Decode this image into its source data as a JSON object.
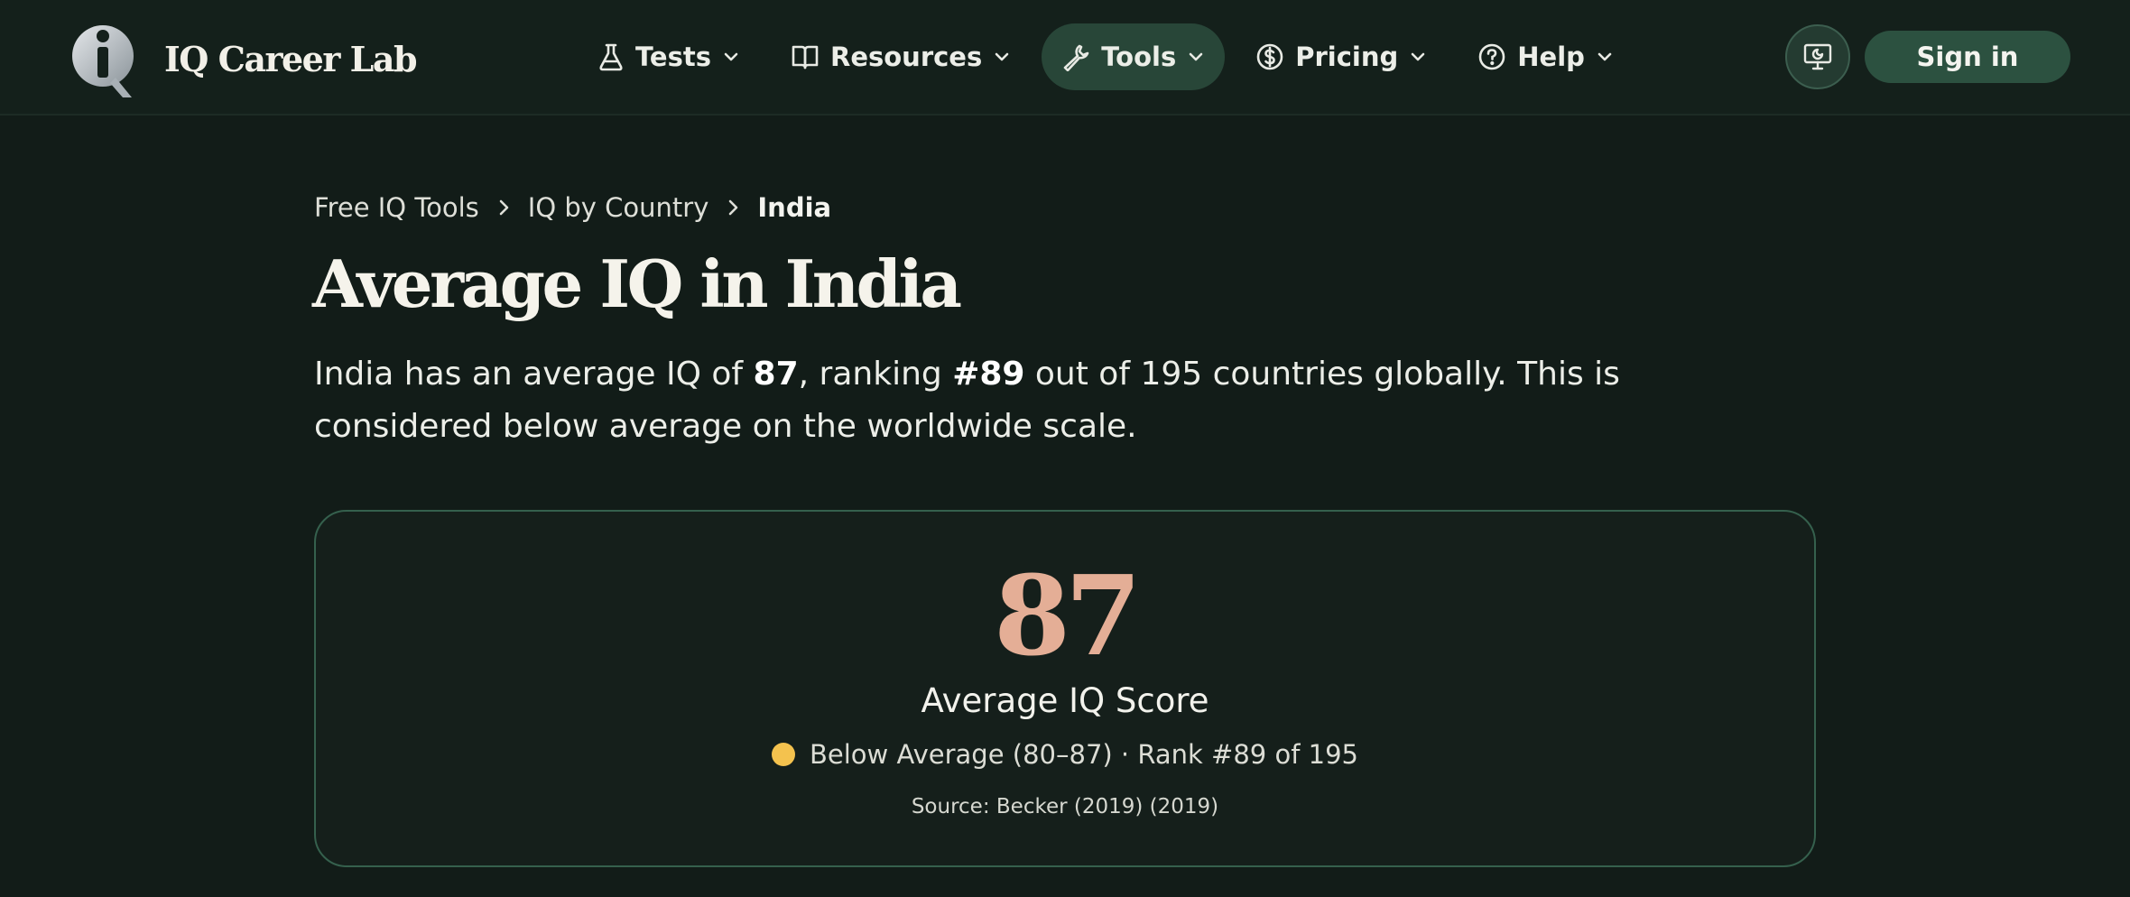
{
  "brand": {
    "name": "IQ Career Lab"
  },
  "nav": {
    "items": [
      {
        "label": "Tests",
        "icon": "flask-icon"
      },
      {
        "label": "Resources",
        "icon": "book-icon"
      },
      {
        "label": "Tools",
        "icon": "wrench-icon",
        "active": true
      },
      {
        "label": "Pricing",
        "icon": "dollar-circle-icon"
      },
      {
        "label": "Help",
        "icon": "help-circle-icon"
      }
    ],
    "theme_toggle_icon": "monitor-icon",
    "signin_label": "Sign in"
  },
  "breadcrumb": {
    "items": [
      "Free IQ Tools",
      "IQ by Country"
    ],
    "current": "India"
  },
  "page": {
    "title": "Average IQ in India",
    "intro": {
      "p1": "India has an average IQ of ",
      "score": "87",
      "p2": ", ranking ",
      "rank": "#89",
      "p3": " out of 195 countries globally. This is considered below average on the worldwide scale."
    }
  },
  "stat_card": {
    "score": "87",
    "label": "Average IQ Score",
    "category": "Below Average (80–87) · Rank #89 of 195",
    "source": "Source: Becker (2019) (2019)"
  },
  "colors": {
    "background": "#121c18",
    "accent_green": "#2c5140",
    "score_color": "#e4ae96",
    "status_dot": "#f4c24e"
  }
}
